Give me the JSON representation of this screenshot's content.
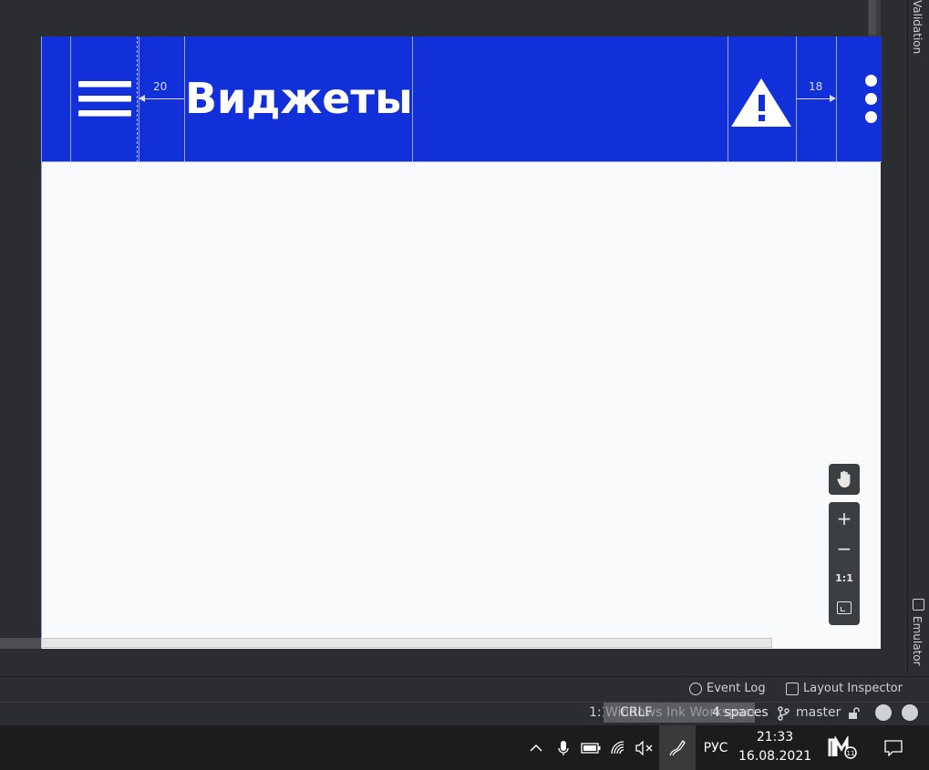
{
  "app_bar": {
    "title": "Виджеты",
    "left_spacing": "20",
    "right_spacing": "18"
  },
  "right_tool_strip": {
    "validation_label": "Validation",
    "emulator_label": "Emulator"
  },
  "zoom_controls": {
    "zoom_in": "+",
    "zoom_out": "−",
    "actual_size": "1:1"
  },
  "tool_windows": {
    "event_log": "Event Log",
    "layout_inspector": "Layout Inspector"
  },
  "status_bar": {
    "position": "1:1",
    "line_separator": "CRLF",
    "ghost_overlay": "Windows Ink Workspace",
    "indent": "4 spaces",
    "branch": "master"
  },
  "taskbar": {
    "language": "РУС",
    "time": "21:33",
    "date": "16.08.2021"
  },
  "colors": {
    "app_bar": "#1230d9",
    "canvas": "#f9fafb",
    "ide_bg": "#2b2d30"
  }
}
